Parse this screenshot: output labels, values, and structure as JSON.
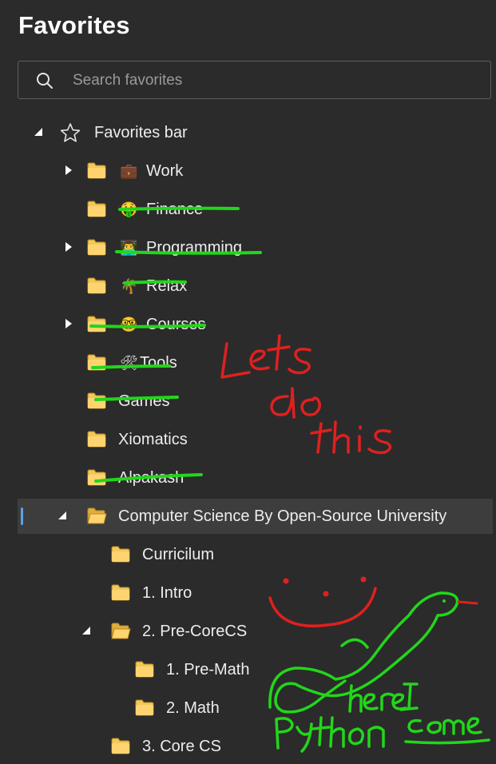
{
  "header": {
    "title": "Favorites"
  },
  "search": {
    "placeholder": "Search favorites",
    "icon": "search-icon"
  },
  "tree": {
    "root": {
      "label": "Favorites bar",
      "icon": "star-icon",
      "expanded": true
    },
    "items": [
      {
        "label": "Work",
        "emoji": "💼",
        "expandable": true
      },
      {
        "label": "Finance",
        "emoji": "🤑",
        "expandable": false
      },
      {
        "label": "Programming",
        "emoji": "👨‍💻",
        "expandable": true
      },
      {
        "label": "Relax",
        "emoji": "🌴",
        "expandable": false
      },
      {
        "label": "Courses",
        "emoji": "🤓",
        "expandable": true
      },
      {
        "label": "Tools",
        "emoji": "🛠",
        "expandable": false
      },
      {
        "label": "Games",
        "emoji": "",
        "expandable": false
      },
      {
        "label": "Xiomatics",
        "emoji": "",
        "expandable": false
      },
      {
        "label": "Alpakash",
        "emoji": "",
        "expandable": false
      },
      {
        "label": "Computer Science By Open-Source University",
        "emoji": "",
        "expandable": true,
        "expanded": true,
        "selected": true
      },
      {
        "label": "Curricilum",
        "emoji": "",
        "expandable": false
      },
      {
        "label": "1. Intro",
        "emoji": "",
        "expandable": false
      },
      {
        "label": "2. Pre-CoreCS",
        "emoji": "",
        "expandable": true,
        "expanded": true
      },
      {
        "label": "1. Pre-Math",
        "emoji": "",
        "expandable": false
      },
      {
        "label": "2. Math",
        "emoji": "",
        "expandable": false
      },
      {
        "label": "3. Core CS",
        "emoji": "",
        "expandable": false
      }
    ]
  },
  "annotations": {
    "red_text": [
      "Lets",
      "do",
      "this"
    ],
    "green_text": [
      "here I",
      "Python",
      "come"
    ],
    "colors": {
      "red": "#e0201f",
      "green": "#22d61a",
      "accent": "#5aa2e6",
      "folder": "#f2c75c"
    }
  }
}
